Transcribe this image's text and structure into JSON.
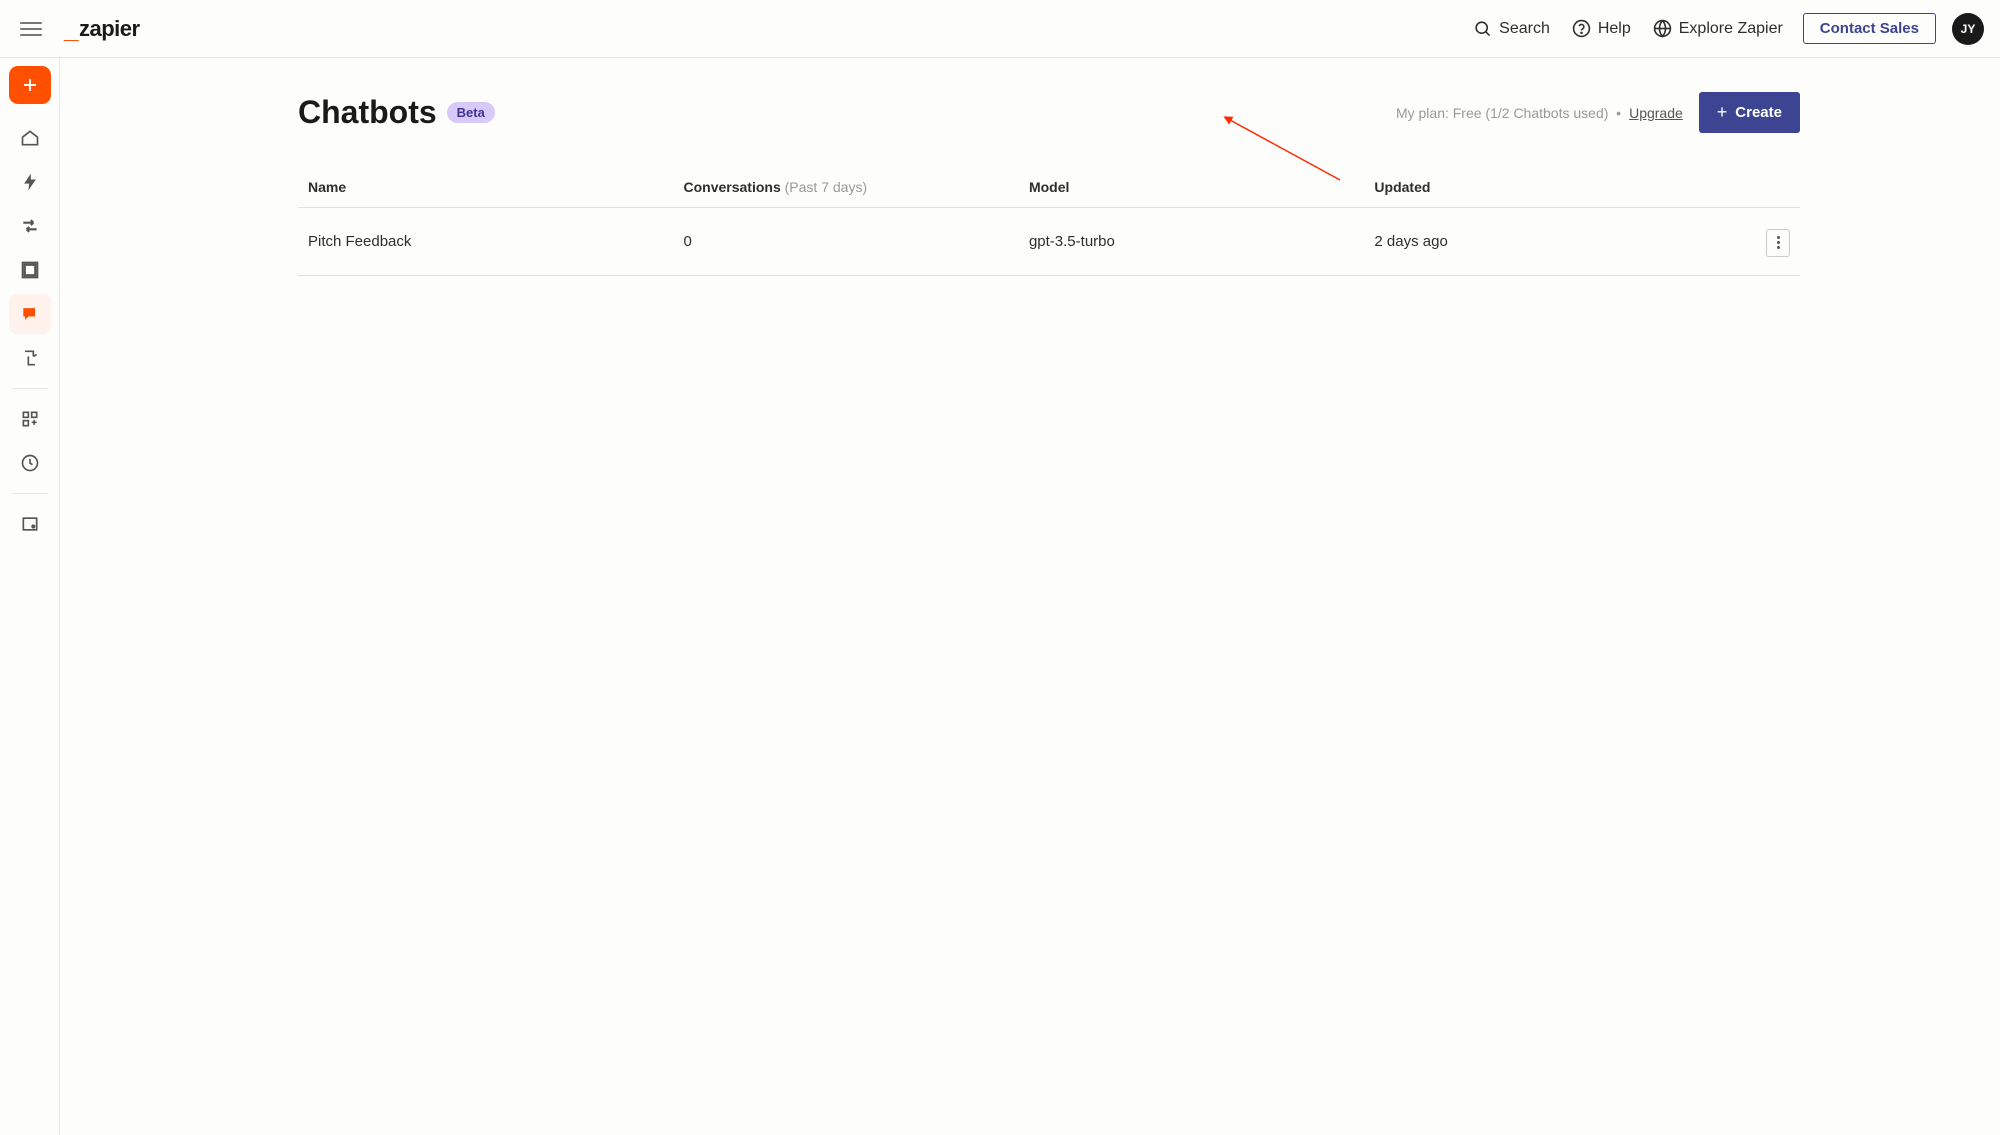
{
  "topbar": {
    "logo_text": "zapier",
    "search_label": "Search",
    "help_label": "Help",
    "explore_label": "Explore Zapier",
    "contact_sales_label": "Contact Sales",
    "avatar_initials": "JY"
  },
  "sidebar": {
    "items": [
      {
        "name": "home",
        "icon": "home"
      },
      {
        "name": "zaps",
        "icon": "bolt"
      },
      {
        "name": "transfers",
        "icon": "transfers"
      },
      {
        "name": "tables",
        "icon": "table"
      },
      {
        "name": "chatbots",
        "icon": "chatbot",
        "active": true
      },
      {
        "name": "interfaces",
        "icon": "interfaces"
      }
    ],
    "secondary": [
      {
        "name": "apps",
        "icon": "apps"
      },
      {
        "name": "history",
        "icon": "clock"
      }
    ],
    "tertiary": [
      {
        "name": "archive",
        "icon": "archive"
      }
    ]
  },
  "page": {
    "title": "Chatbots",
    "badge": "Beta",
    "plan_text": "My plan: Free (1/2 Chatbots used)",
    "separator": "•",
    "upgrade_label": "Upgrade",
    "create_label": "Create"
  },
  "table": {
    "columns": {
      "name": "Name",
      "conversations": "Conversations",
      "conversations_sub": "(Past 7 days)",
      "model": "Model",
      "updated": "Updated"
    },
    "rows": [
      {
        "name": "Pitch Feedback",
        "conversations": "0",
        "model": "gpt-3.5-turbo",
        "updated": "2 days ago"
      }
    ]
  }
}
